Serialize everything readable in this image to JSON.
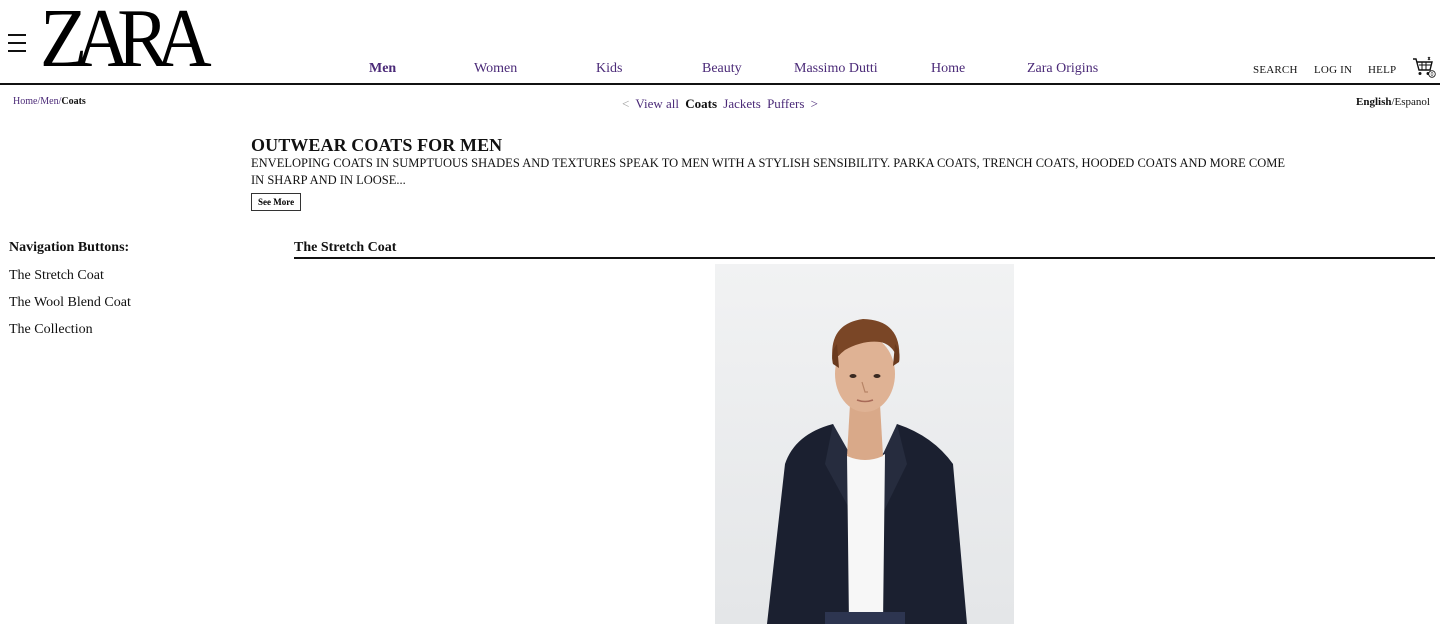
{
  "header": {
    "logo": "ZARA",
    "nav": [
      {
        "label": "Men",
        "active": true
      },
      {
        "label": "Women",
        "active": false
      },
      {
        "label": "Kids",
        "active": false
      },
      {
        "label": "Beauty",
        "active": false
      },
      {
        "label": "Massimo Dutti",
        "active": false
      },
      {
        "label": "Home",
        "active": false
      },
      {
        "label": "Zara Origins",
        "active": false
      }
    ],
    "utility": {
      "search": "SEARCH",
      "login": "LOG IN",
      "help": "HELP"
    },
    "cart_count": "0",
    "colors": {
      "link": "#4b2a78",
      "text": "#111111",
      "rule": "#111111"
    }
  },
  "breadcrumb": {
    "home": "Home",
    "sep1": "/",
    "men": "Men",
    "sep2": "/",
    "current": "Coats"
  },
  "subnav": {
    "prev_arrow": "<",
    "view_all": "View all",
    "current": "Coats",
    "jackets": "Jackets",
    "puffers": "Puffers",
    "next_arrow": ">"
  },
  "language": {
    "current": "English",
    "sep": "/",
    "other": "Espanol"
  },
  "intro": {
    "title": "OUTWEAR COATS FOR MEN",
    "description": "ENVELOPING COATS IN SUMPTUOUS SHADES AND TEXTURES SPEAK TO MEN WITH A STYLISH SENSIBILITY. PARKA COATS, TRENCH COATS, HOODED COATS AND MORE COME IN SHARP AND IN LOOSE...",
    "see_more": "See More"
  },
  "sidenav": {
    "title": "Navigation Buttons:",
    "items": [
      "The Stretch Coat",
      "The Wool Blend Coat",
      "The Collection"
    ]
  },
  "section": {
    "title": "The Stretch Coat",
    "image_icon": "product-photo-model-in-navy-coat"
  }
}
